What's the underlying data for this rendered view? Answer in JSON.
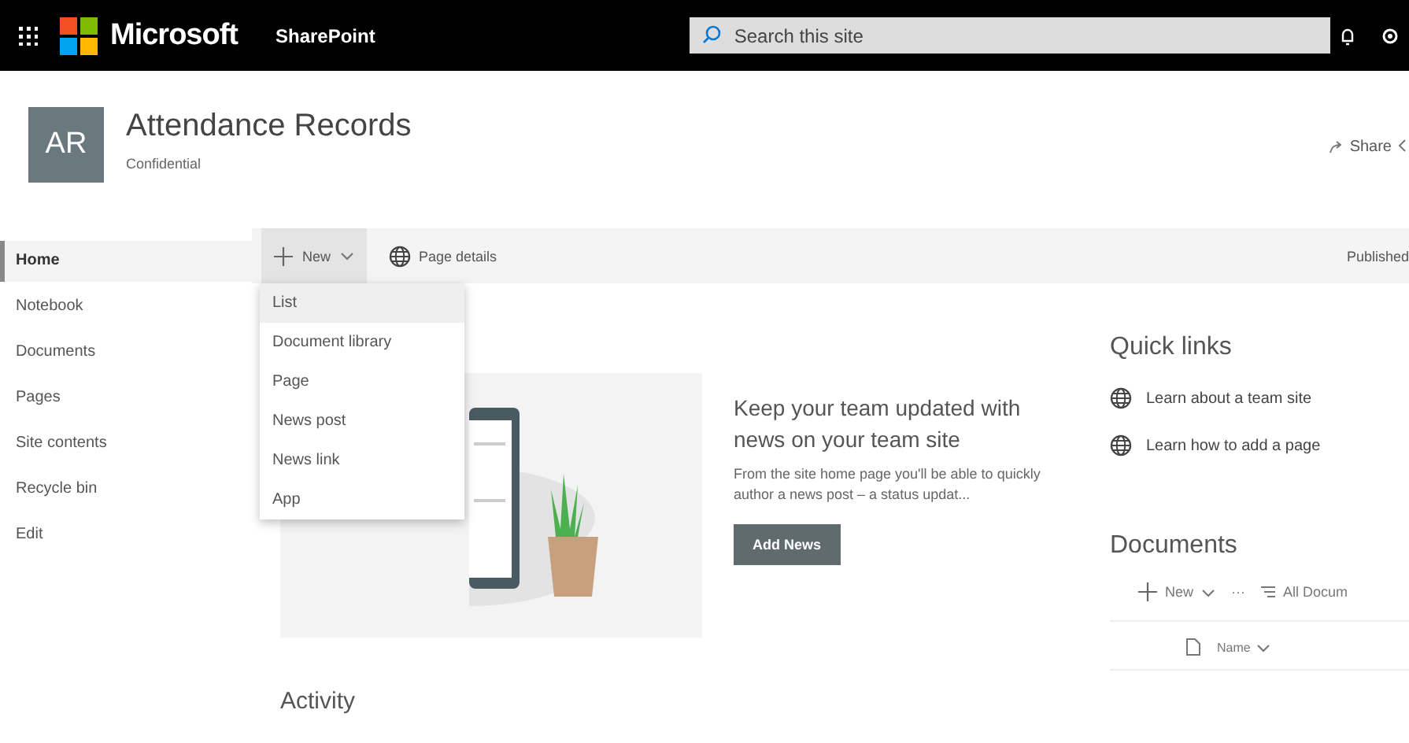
{
  "top_bar": {
    "brand": "Microsoft",
    "app": "SharePoint",
    "search": {
      "placeholder": "Search this site"
    }
  },
  "site": {
    "logo": "AR",
    "title": "Attendance Records",
    "subtitle": "Confidential",
    "share": "Share"
  },
  "nav": {
    "items": [
      {
        "label": "Home",
        "selected": true
      },
      {
        "label": "Notebook",
        "selected": false
      },
      {
        "label": "Documents",
        "selected": false
      },
      {
        "label": "Pages",
        "selected": false
      },
      {
        "label": "Site contents",
        "selected": false
      },
      {
        "label": "Recycle bin",
        "selected": false
      },
      {
        "label": "Edit",
        "selected": false
      }
    ]
  },
  "command_bar": {
    "new": "New",
    "page_details": "Page details",
    "status": "Published"
  },
  "new_menu": {
    "items": [
      {
        "label": "List",
        "selected": true
      },
      {
        "label": "Document library",
        "selected": false
      },
      {
        "label": "Page",
        "selected": false
      },
      {
        "label": "News post",
        "selected": false
      },
      {
        "label": "News link",
        "selected": false
      },
      {
        "label": "App",
        "selected": false
      }
    ]
  },
  "news": {
    "heading": "Keep your team updated with news on your team site",
    "body": "From the site home page you'll be able to quickly author a news post – a status updat...",
    "button": "Add News"
  },
  "quick_links": {
    "title": "Quick links",
    "items": [
      "Learn about a team site",
      "Learn how to add a page"
    ]
  },
  "documents": {
    "title": "Documents",
    "new": "New",
    "more": "···",
    "view": "All Docum",
    "column": "Name"
  },
  "activity": {
    "title": "Activity"
  }
}
